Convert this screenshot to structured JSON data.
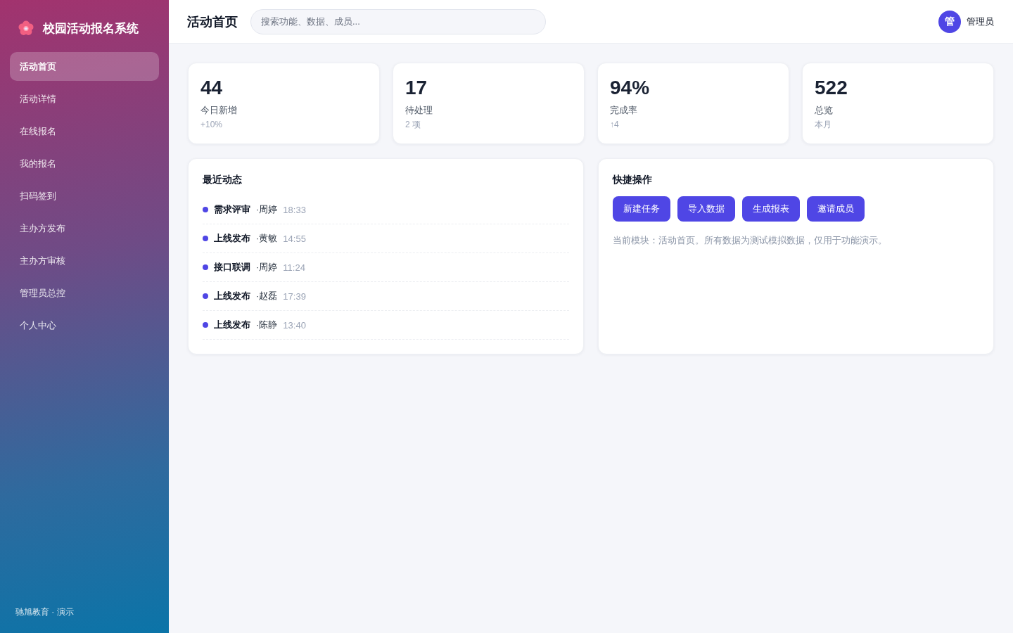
{
  "sidebar": {
    "brand": "校园活动报名系统",
    "items": [
      {
        "label": "活动首页",
        "selected": true
      },
      {
        "label": "活动详情",
        "selected": false
      },
      {
        "label": "在线报名",
        "selected": false
      },
      {
        "label": "我的报名",
        "selected": false
      },
      {
        "label": "扫码签到",
        "selected": false
      },
      {
        "label": "主办方发布",
        "selected": false
      },
      {
        "label": "主办方审核",
        "selected": false
      },
      {
        "label": "管理员总控",
        "selected": false
      },
      {
        "label": "个人中心",
        "selected": false
      }
    ],
    "footer": "驰旭教育 · 演示"
  },
  "header": {
    "title": "活动首页",
    "search": {
      "placeholder": "搜索功能、数据、成员..."
    },
    "user": {
      "avatar": "管",
      "name": "管理员"
    }
  },
  "stats": [
    {
      "value": "44",
      "label": "今日新增",
      "note": "+10%"
    },
    {
      "value": "17",
      "label": "待处理",
      "note": "2 项"
    },
    {
      "value": "94%",
      "label": "完成率",
      "note": "↑4"
    },
    {
      "value": "522",
      "label": "总览",
      "note": "本月"
    }
  ],
  "recent": {
    "title": "最近动态",
    "items": [
      {
        "title": "需求评审",
        "person": "·周婷",
        "time": "18:33"
      },
      {
        "title": "上线发布",
        "person": "·黄敏",
        "time": "14:55"
      },
      {
        "title": "接口联调",
        "person": "·周婷",
        "time": "11:24"
      },
      {
        "title": "上线发布",
        "person": "·赵磊",
        "time": "17:39"
      },
      {
        "title": "上线发布",
        "person": "·陈静",
        "time": "13:40"
      }
    ]
  },
  "quick": {
    "title": "快捷操作",
    "buttons": [
      "新建任务",
      "导入数据",
      "生成报表",
      "邀请成员"
    ],
    "note": "当前模块：活动首页。所有数据为测试模拟数据，仅用于功能演示。"
  }
}
